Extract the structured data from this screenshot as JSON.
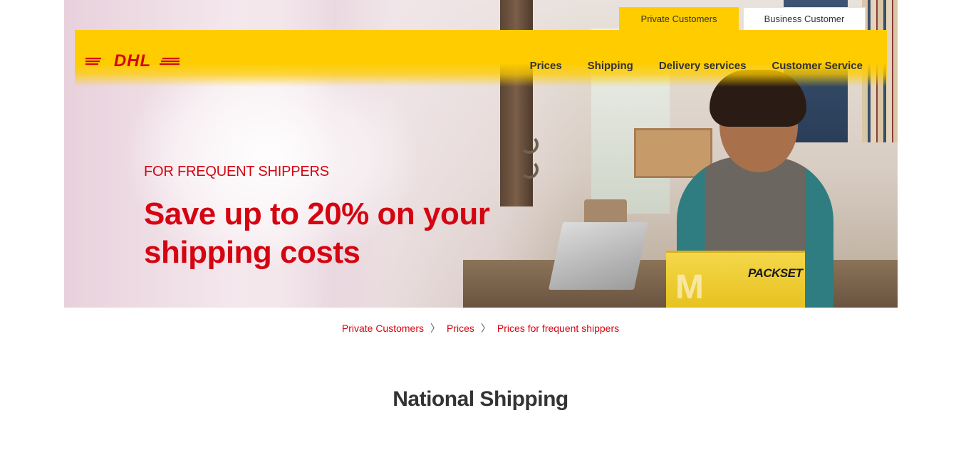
{
  "customer_tabs": {
    "private_label": "Private Customers",
    "business_label": "Business Customer"
  },
  "header": {
    "logo_text": "DHL",
    "nav": [
      "Prices",
      "Shipping",
      "Delivery services",
      "Customer Service"
    ]
  },
  "hero": {
    "eyebrow": "FOR FREQUENT SHIPPERS",
    "headline_line1": "Save up to 20% on your",
    "headline_line2": "shipping costs",
    "box_label": "PACKSET",
    "box_mark": "M"
  },
  "breadcrumb": [
    "Private Customers",
    "Prices",
    "Prices for frequent shippers"
  ],
  "breadcrumb_separator": "〉",
  "section": {
    "title": "National Shipping"
  },
  "colors": {
    "brand_yellow": "#ffcc00",
    "brand_red": "#d40511",
    "text_dark": "#333333"
  }
}
